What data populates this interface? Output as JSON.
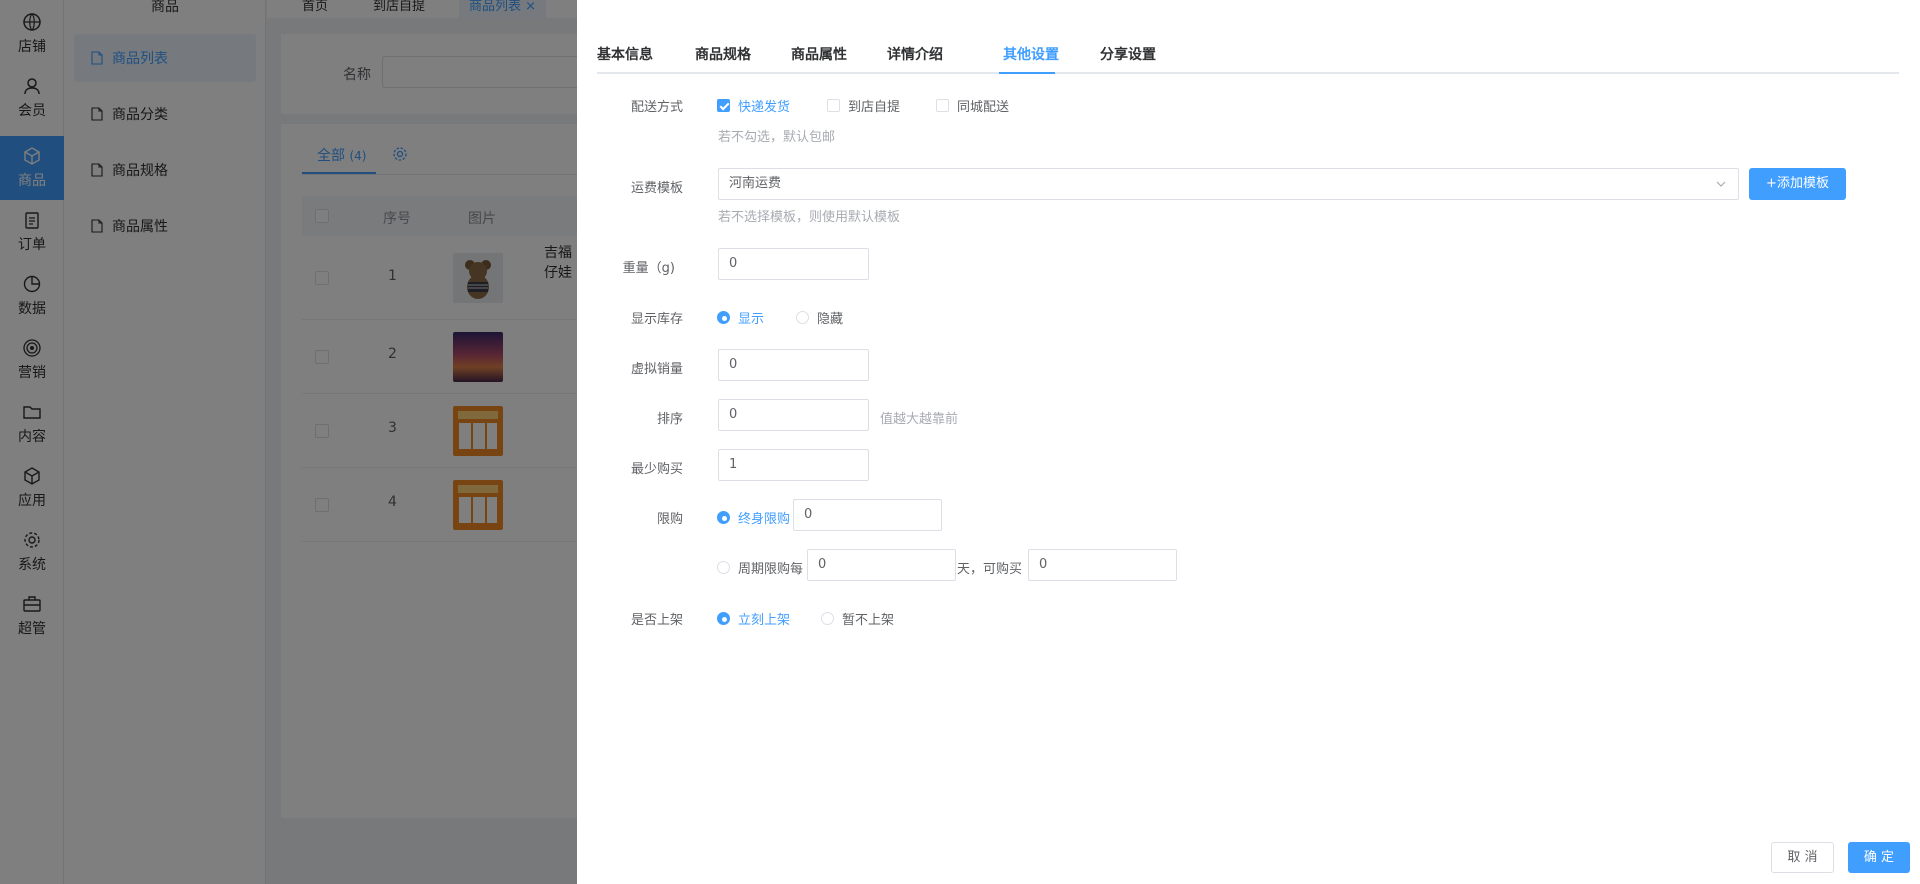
{
  "rail": {
    "items": [
      {
        "label": "店铺",
        "icon": "globe-icon"
      },
      {
        "label": "会员",
        "icon": "user-icon"
      },
      {
        "label": "商品",
        "icon": "box-icon"
      },
      {
        "label": "订单",
        "icon": "clipboard-icon"
      },
      {
        "label": "数据",
        "icon": "pie-chart-icon"
      },
      {
        "label": "营销",
        "icon": "target-icon"
      },
      {
        "label": "内容",
        "icon": "folder-icon"
      },
      {
        "label": "应用",
        "icon": "cube-icon"
      },
      {
        "label": "系统",
        "icon": "gear-icon"
      },
      {
        "label": "超管",
        "icon": "briefcase-icon"
      }
    ]
  },
  "subnav": {
    "title": "商品",
    "items": [
      {
        "label": "商品列表"
      },
      {
        "label": "商品分类"
      },
      {
        "label": "商品规格"
      },
      {
        "label": "商品属性"
      }
    ]
  },
  "tabs": [
    {
      "label": "首页"
    },
    {
      "label": "到店自提"
    },
    {
      "label": "商品列表"
    }
  ],
  "filter": {
    "name_label": "名称"
  },
  "list": {
    "tab_all": "全部",
    "tab_all_count": "(4)",
    "headers": {
      "index": "序号",
      "image": "图片"
    },
    "rows": [
      {
        "index": "1",
        "title_line1": "吉福",
        "title_line2": "仔娃"
      },
      {
        "index": "2"
      },
      {
        "index": "3"
      },
      {
        "index": "4"
      }
    ]
  },
  "drawer": {
    "tabs": [
      "基本信息",
      "商品规格",
      "商品属性",
      "详情介绍",
      "其他设置",
      "分享设置"
    ],
    "delivery": {
      "label": "配送方式",
      "options": [
        "快递发货",
        "到店自提",
        "同城配送"
      ],
      "hint": "若不勾选，默认包邮"
    },
    "freight": {
      "label": "运费模板",
      "value": "河南运费",
      "add_button": "+添加模板",
      "hint": "若不选择模板，则使用默认模板"
    },
    "weight": {
      "label": "重量（g)",
      "value": "0"
    },
    "stock": {
      "label": "显示库存",
      "options": [
        "显示",
        "隐藏"
      ]
    },
    "virtual_sales": {
      "label": "虚拟销量",
      "value": "0"
    },
    "sort": {
      "label": "排序",
      "value": "0",
      "hint": "值越大越靠前"
    },
    "min_buy": {
      "label": "最少购买",
      "value": "1"
    },
    "limit": {
      "label": "限购",
      "lifetime_label": "终身限购",
      "lifetime_value": "0",
      "period_label": "周期限购每",
      "period_days": "0",
      "days_text": "天，可购买",
      "period_qty": "0"
    },
    "publish": {
      "label": "是否上架",
      "options": [
        "立刻上架",
        "暂不上架"
      ]
    },
    "cancel": "取 消",
    "confirm": "确 定"
  },
  "colors": {
    "primary": "#409eff"
  }
}
